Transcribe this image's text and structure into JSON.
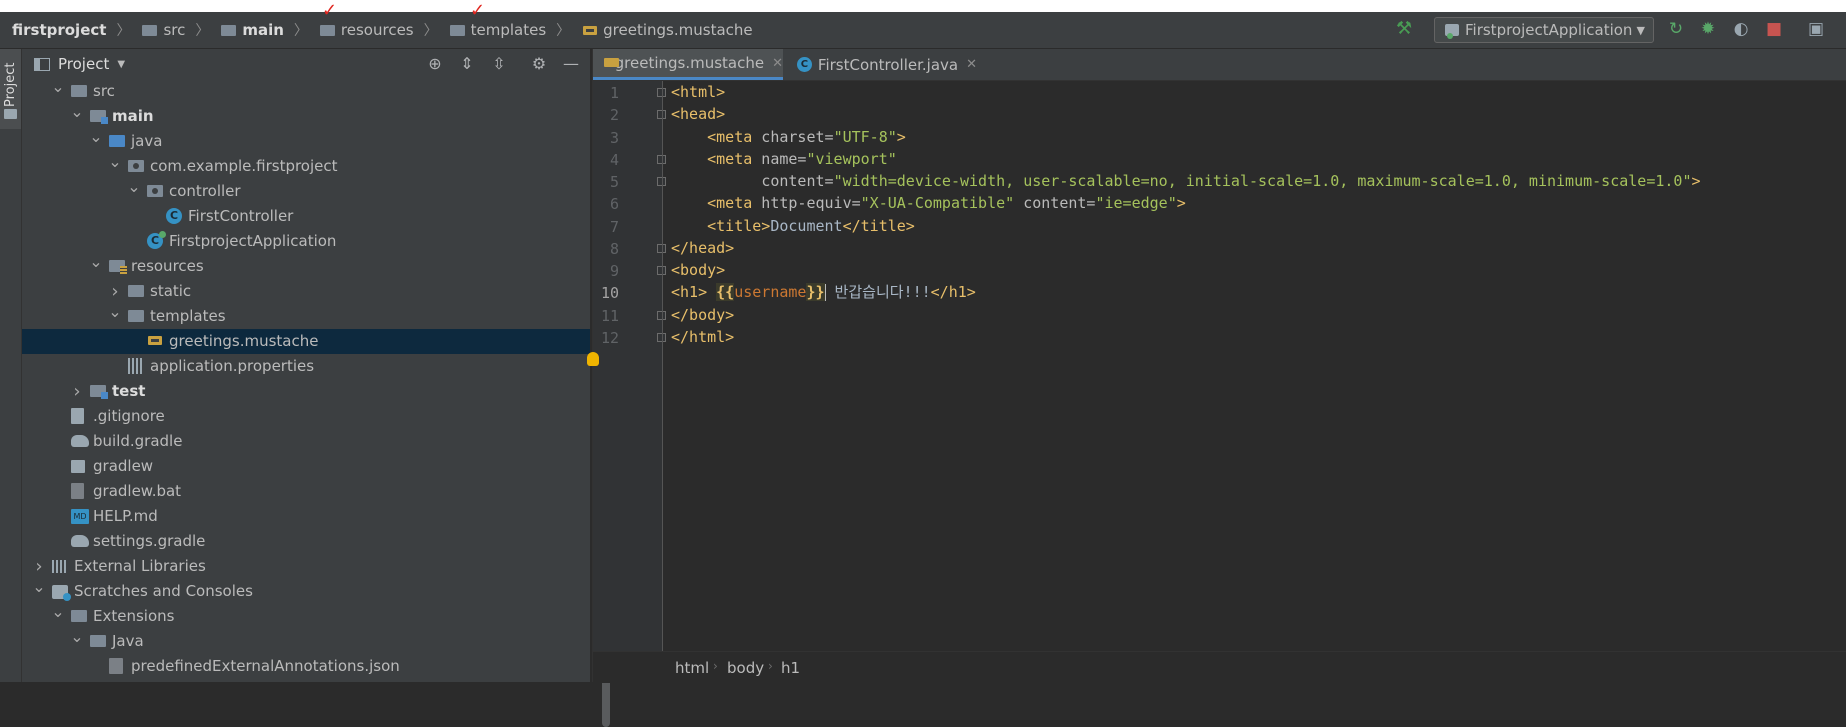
{
  "breadcrumbs": [
    {
      "label": "firstproject",
      "bold": true
    },
    {
      "label": "src"
    },
    {
      "label": "main",
      "bold": true
    },
    {
      "label": "resources"
    },
    {
      "label": "templates"
    },
    {
      "label": "greetings.mustache"
    }
  ],
  "run_config": {
    "label": "FirstprojectApplication"
  },
  "left_strip": {
    "label": "Project"
  },
  "project_panel": {
    "title": "Project"
  },
  "tree": [
    {
      "label": "src",
      "level": 1,
      "arrow": "down",
      "icon": "folder"
    },
    {
      "label": "main",
      "level": 2,
      "arrow": "down",
      "icon": "folder-module",
      "bold": true
    },
    {
      "label": "java",
      "level": 3,
      "arrow": "down",
      "icon": "folder-blue"
    },
    {
      "label": "com.example.firstproject",
      "level": 4,
      "arrow": "down",
      "icon": "package"
    },
    {
      "label": "controller",
      "level": 5,
      "arrow": "down",
      "icon": "package"
    },
    {
      "label": "FirstController",
      "level": 6,
      "icon": "class"
    },
    {
      "label": "FirstprojectApplication",
      "level": 5,
      "icon": "class-app"
    },
    {
      "label": "resources",
      "level": 3,
      "arrow": "down",
      "icon": "folder-res"
    },
    {
      "label": "static",
      "level": 4,
      "arrow": "right",
      "icon": "folder"
    },
    {
      "label": "templates",
      "level": 4,
      "arrow": "down",
      "icon": "folder"
    },
    {
      "label": "greetings.mustache",
      "level": 5,
      "icon": "mustache",
      "selected": true
    },
    {
      "label": "application.properties",
      "level": 4,
      "icon": "properties"
    },
    {
      "label": "test",
      "level": 2,
      "arrow": "right",
      "icon": "folder-module",
      "bold": true
    },
    {
      "label": ".gitignore",
      "level": 1,
      "icon": "file"
    },
    {
      "label": "build.gradle",
      "level": 1,
      "icon": "gradle"
    },
    {
      "label": "gradlew",
      "level": 1,
      "icon": "terminal"
    },
    {
      "label": "gradlew.bat",
      "level": 1,
      "icon": "file-dark"
    },
    {
      "label": "HELP.md",
      "level": 1,
      "icon": "md"
    },
    {
      "label": "settings.gradle",
      "level": 1,
      "icon": "gradle"
    },
    {
      "label": "External Libraries",
      "level": 0,
      "arrow": "right",
      "icon": "library"
    },
    {
      "label": "Scratches and Consoles",
      "level": 0,
      "arrow": "down",
      "icon": "scratch"
    },
    {
      "label": "Extensions",
      "level": 1,
      "arrow": "down",
      "icon": "folder"
    },
    {
      "label": "Java",
      "level": 2,
      "arrow": "down",
      "icon": "folder"
    },
    {
      "label": "predefinedExternalAnnotations.json",
      "level": 3,
      "icon": "json"
    }
  ],
  "editor_tabs": [
    {
      "label": "greetings.mustache",
      "active": true,
      "icon": "mustache"
    },
    {
      "label": "FirstController.java",
      "active": false,
      "icon": "class"
    }
  ],
  "line_numbers": [
    "1",
    "2",
    "3",
    "4",
    "5",
    "6",
    "7",
    "8",
    "9",
    "10",
    "11",
    "12"
  ],
  "current_line": "10",
  "code": {
    "l1": {
      "tag": "<html>"
    },
    "l2": {
      "tag": "<head>"
    },
    "l3": {
      "indent": "    ",
      "tag_open": "<meta",
      "a1": " charset=",
      "v1": "\"UTF-8\"",
      "tag_close": ">"
    },
    "l4": {
      "indent": "    ",
      "tag_open": "<meta",
      "a1": " name=",
      "v1": "\"viewport\""
    },
    "l5": {
      "indent": "          ",
      "a1": "content=",
      "v1": "\"width=device-width, user-scalable=no, initial-scale=1.0, maximum-scale=1.0, minimum-scale=1.0\"",
      "tag_close": ">"
    },
    "l6": {
      "indent": "    ",
      "tag_open": "<meta",
      "a1": " http-equiv=",
      "v1": "\"X-UA-Compatible\"",
      "a2": " content=",
      "v2": "\"ie=edge\"",
      "tag_close": ">"
    },
    "l7": {
      "indent": "    ",
      "tag_open": "<title>",
      "text": "Document",
      "tag_close": "</title>"
    },
    "l8": {
      "tag": "</head>"
    },
    "l9": {
      "tag": "<body>"
    },
    "l10": {
      "tag_open": "<h1>",
      "sp": " ",
      "m_open": "{{",
      "m_var": "username",
      "m_close": "}}",
      "text": " 반갑습니다!!!",
      "tag_close": "</h1>"
    },
    "l11": {
      "tag": "</body>"
    },
    "l12": {
      "tag": "</html>"
    }
  },
  "status_breadcrumbs": [
    "html",
    "body",
    "h1"
  ]
}
